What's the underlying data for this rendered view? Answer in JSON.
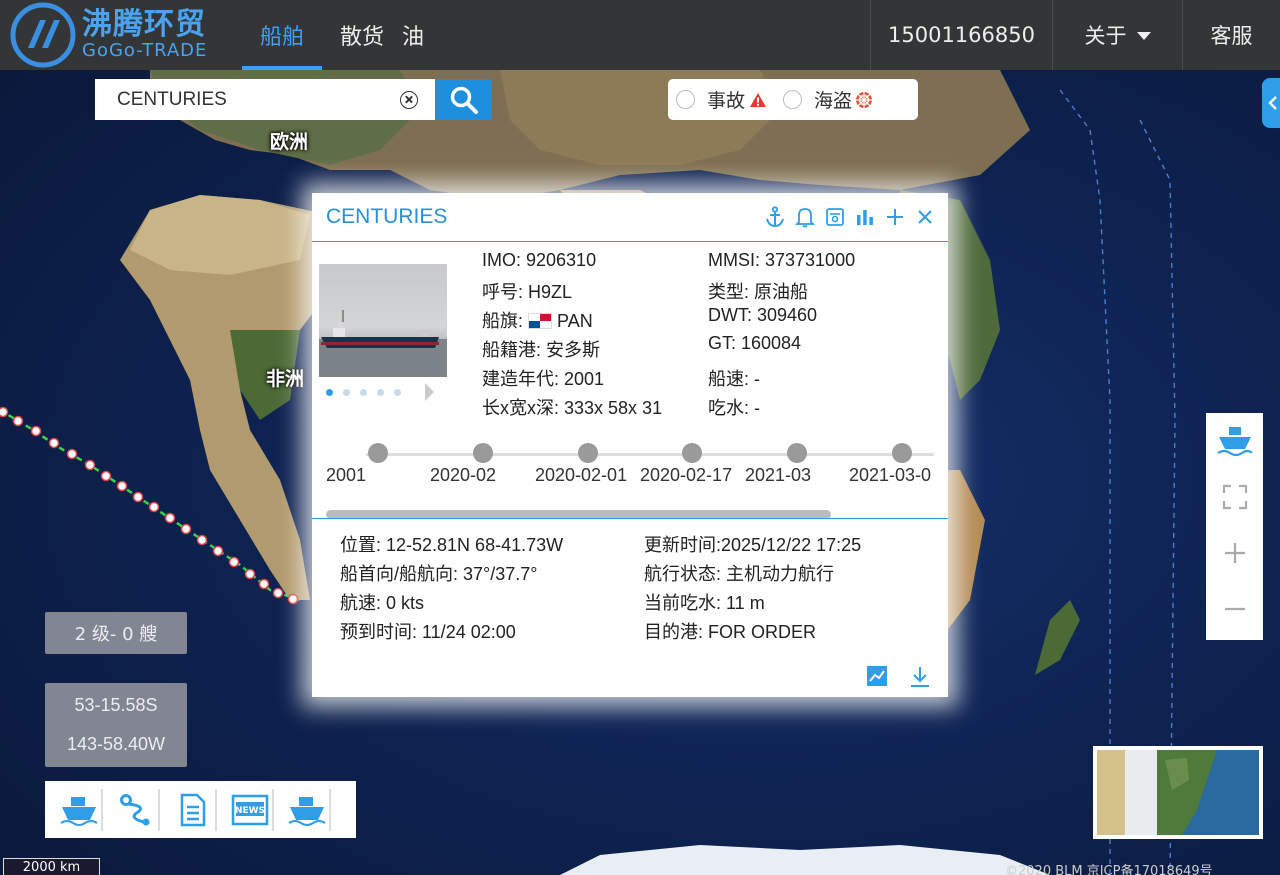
{
  "brand": {
    "name_cn": "沸腾环贸",
    "name_en": "GoGo-TRADE"
  },
  "nav": {
    "tabs": [
      {
        "label": "船舶",
        "active": true
      },
      {
        "label": "散货",
        "active": false
      },
      {
        "label": "油",
        "active": false
      }
    ],
    "phone": "15001166850",
    "about": "关于",
    "service": "客服"
  },
  "search": {
    "value": "CENTURIES",
    "placeholder": ""
  },
  "filters": {
    "accident": "事故",
    "pirate": "海盗"
  },
  "map_labels": {
    "europe": "欧洲",
    "africa": "非洲"
  },
  "ship": {
    "name": "CENTURIES",
    "imo": "IMO: 9206310",
    "mmsi": "MMSI: 373731000",
    "callsign": "呼号: H9ZL",
    "type": "类型: 原油船",
    "flag_label": "船旗:",
    "flag_code": "PAN",
    "dwt": "DWT: 309460",
    "port": "船籍港: 安多斯",
    "gt": "GT: 160084",
    "built": "建造年代: 2001",
    "speed": "船速: -",
    "dims": "长x宽x深: 333x 58x 31",
    "draft": "吃水: -"
  },
  "timeline": [
    "2001",
    "2020-02",
    "2020-02-01",
    "2020-02-17",
    "2021-03",
    "2021-03-0"
  ],
  "position": {
    "pos": "位置: 12-52.81N 68-41.73W",
    "updated": "更新时间:2025/12/22 17:25",
    "heading": "船首向/船航向: 37°/37.7°",
    "status": "航行状态: 主机动力航行",
    "sog": "航速: 0 kts",
    "cur_draft": "当前吃水: 11 m",
    "eta": "预到时间: 11/24 02:00",
    "dest": "目的港: FOR ORDER"
  },
  "widgets": {
    "level": "2 级- 0 艘",
    "lat": "53-15.58S",
    "lon": "143-58.40W",
    "scale": "2000 km",
    "copyright": "©2020 BLM 京ICP备17018649号"
  },
  "colors": {
    "accent": "#2f9ee8",
    "topbar": "#333536",
    "route": "#3bd14a"
  }
}
